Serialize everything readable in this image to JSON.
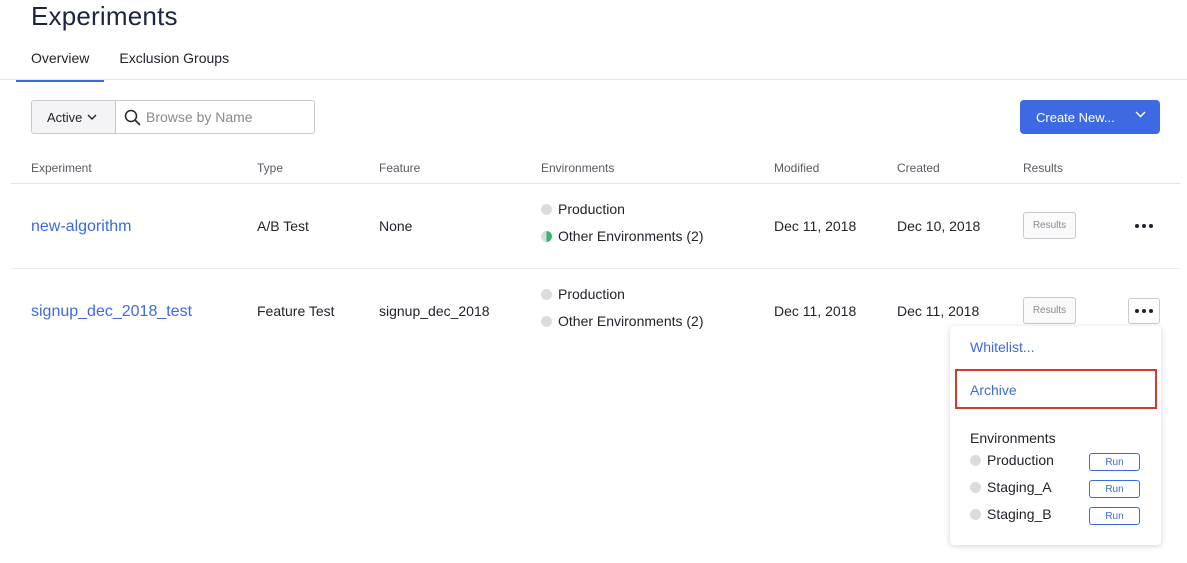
{
  "page": {
    "title": "Experiments"
  },
  "tabs": [
    {
      "label": "Overview",
      "active": true
    },
    {
      "label": "Exclusion Groups",
      "active": false
    }
  ],
  "filters": {
    "status_value": "Active",
    "search_placeholder": "Browse by Name",
    "search_value": ""
  },
  "create_button": {
    "label": "Create New..."
  },
  "table": {
    "columns": [
      "Experiment",
      "Type",
      "Feature",
      "Environments",
      "Modified",
      "Created",
      "Results"
    ],
    "rows": [
      {
        "name": "new-algorithm",
        "type": "A/B Test",
        "feature": "None",
        "environments": [
          {
            "label": "Production",
            "status": "off"
          },
          {
            "label": "Other Environments (2)",
            "status": "partial"
          }
        ],
        "modified": "Dec 11, 2018",
        "created": "Dec 10, 2018",
        "results_label": "Results"
      },
      {
        "name": "signup_dec_2018_test",
        "type": "Feature Test",
        "feature": "signup_dec_2018",
        "environments": [
          {
            "label": "Production",
            "status": "off"
          },
          {
            "label": "Other Environments (2)",
            "status": "off"
          }
        ],
        "modified": "Dec 11, 2018",
        "created": "Dec 11, 2018",
        "results_label": "Results"
      }
    ]
  },
  "row_menu": {
    "items": [
      "Whitelist...",
      "Archive"
    ],
    "highlighted_item": "Archive",
    "environments_heading": "Environments",
    "environments": [
      {
        "label": "Production",
        "action": "Run"
      },
      {
        "label": "Staging_A",
        "action": "Run"
      },
      {
        "label": "Staging_B",
        "action": "Run"
      }
    ]
  },
  "colors": {
    "accent": "#3d6ae3",
    "highlight_border": "#d13b2e",
    "status_running": "#2fba6d",
    "status_off": "#dcdce0"
  }
}
